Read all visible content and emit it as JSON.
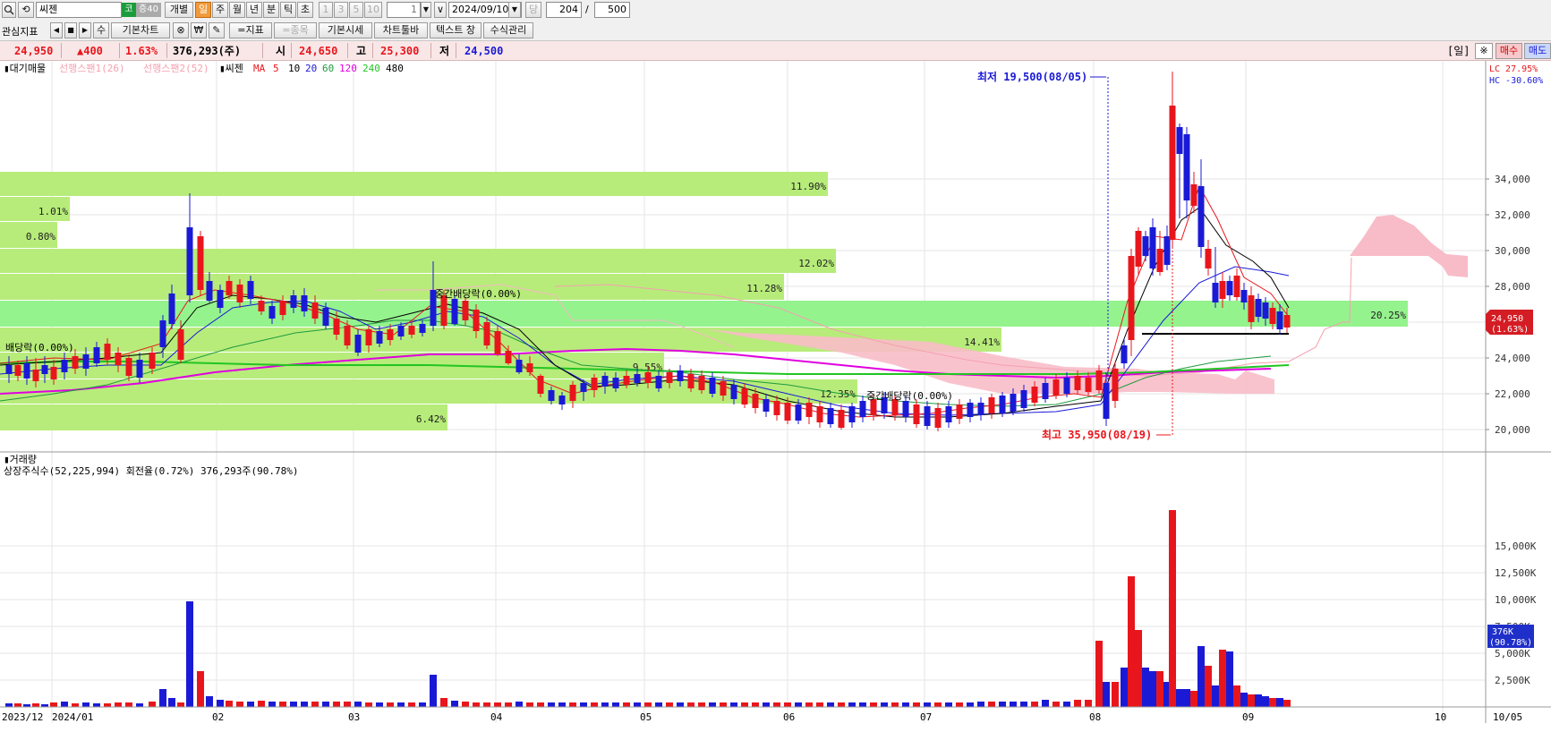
{
  "toolbar": {
    "stock_name": "씨젠",
    "market_badge": "코",
    "margin_badge": "증40",
    "btn_individual": "개별",
    "period_day": "일",
    "period_week": "주",
    "period_month": "월",
    "period_year": "년",
    "period_minute": "분",
    "period_tick": "틱",
    "period_second": "초",
    "interval_1": "1",
    "interval_3": "3",
    "interval_5": "5",
    "interval_10": "10",
    "interval_value": "1",
    "date": "2024/09/10",
    "dang": "당",
    "count_shown": "204",
    "count_total": "500",
    "slash": "/"
  },
  "toolbar2": {
    "watchlist": "관심지표",
    "su": "수",
    "basic_chart": "기본차트",
    "won": "₩",
    "indicator": "=지표",
    "stock": "=종목",
    "basic_price": "기본시세",
    "chart_toolbar": "차트툴바",
    "text_window": "텍스트 창",
    "formula_mgmt": "수식관리"
  },
  "pricebar": {
    "price": "24,950",
    "change": "▲400",
    "change_pct": "1.63%",
    "volume": "376,293(주)",
    "open_label": "시",
    "open": "24,650",
    "high_label": "고",
    "high": "25,300",
    "low_label": "저",
    "low": "24,500",
    "day_label": "[일]",
    "buy": "매수",
    "sell": "매도"
  },
  "legend": {
    "supply": "대기매물",
    "span1": "선행스팬1(26)",
    "span2": "선행스팬2(52)",
    "stock": "씨젠",
    "ma_label": "MA",
    "ma5": "5",
    "ma10": "10",
    "ma20": "20",
    "ma60": "60",
    "ma120": "120",
    "ma240": "240",
    "ma480": "480"
  },
  "annotations": {
    "low_note": "최저 19,500(08/05)",
    "high_note": "최고 35,950(08/19)",
    "div1": "배당락(0.00%)",
    "div2": "중간배당락(0.00%)",
    "div3": "중간배당락(0.00%)",
    "lc": "LC  27.95%",
    "hc": "HC -30.60%",
    "cur_price": "24,950",
    "cur_pct": "(1.63%)"
  },
  "volume_panel": {
    "title": "거래량",
    "info": "상장주식수(52,225,994) 회전율(0.72%) 376,293주(90.78%)",
    "badge1": "376K",
    "badge2": "(90.78%)"
  },
  "colors": {
    "up": "#e8161c",
    "down": "#1a1ad6",
    "supply": "#b7ec7a",
    "supply_hi": "#94f38d",
    "cloud": "#f8bcc8"
  },
  "chart_data": {
    "type": "candlestick",
    "price_axis": [
      20000,
      22000,
      24000,
      26000,
      28000,
      30000,
      32000,
      34000
    ],
    "price_axis_labels": [
      "20,000",
      "22,000",
      "24,000",
      "26,000",
      "28,000",
      "30,000",
      "32,000",
      "34,000"
    ],
    "volume_axis": [
      2500000,
      5000000,
      7500000,
      10000000,
      12500000,
      15000000
    ],
    "volume_axis_labels": [
      "2,500K",
      "5,000K",
      "7,500K",
      "10,000K",
      "12,500K",
      "15,000K"
    ],
    "x_labels": [
      "2023/12",
      "2024/01",
      "02",
      "03",
      "04",
      "05",
      "06",
      "07",
      "08",
      "09",
      "10",
      "10/05"
    ],
    "supply_bands": [
      {
        "low": 33000,
        "high": 34400,
        "pct": "11.90%"
      },
      {
        "low": 31600,
        "high": 33000,
        "pct": "1.01%"
      },
      {
        "low": 30100,
        "high": 31600,
        "pct": "0.80%"
      },
      {
        "low": 28700,
        "high": 30100,
        "pct": "12.02%"
      },
      {
        "low": 27200,
        "high": 28700,
        "pct": "11.28%"
      },
      {
        "low": 25700,
        "high": 27200,
        "pct": "20.25%"
      },
      {
        "low": 24300,
        "high": 25700,
        "pct": "14.41%"
      },
      {
        "low": 22800,
        "high": 24300,
        "pct": "9.55%"
      },
      {
        "low": 21400,
        "high": 22800,
        "pct": "12.35%"
      },
      {
        "low": 19900,
        "high": 21400,
        "pct": "6.42%"
      }
    ],
    "current_price": 24950,
    "high_price": 35950,
    "low_price": 19500,
    "volume_spikes": [
      {
        "x": "2024/02",
        "value": 9300000
      },
      {
        "x": "2024/03",
        "value": 2800000
      },
      {
        "x": "2024/08/05",
        "value": 5400000
      },
      {
        "x": "2024/08/08",
        "value": 10200000
      },
      {
        "x": "2024/08/19",
        "value": 15900000
      },
      {
        "x": "2024/08/29",
        "value": 4200000
      }
    ]
  }
}
